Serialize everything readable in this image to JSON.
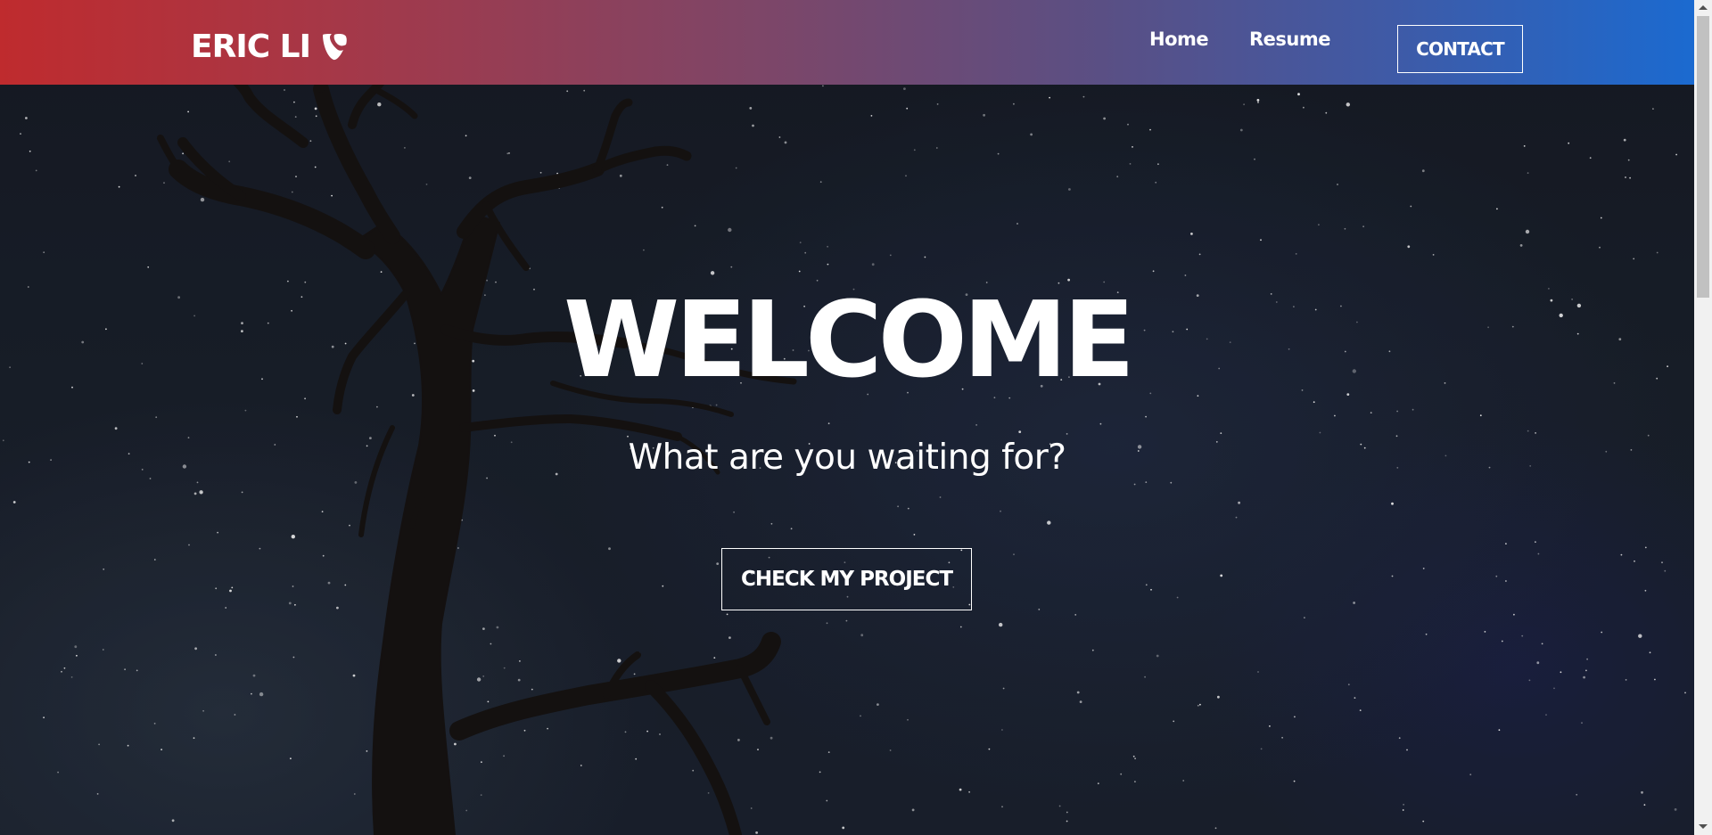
{
  "navbar": {
    "brand": "ERIC LI",
    "brand_logo_icon": "typo3-logo-icon",
    "links": [
      {
        "label": "Home"
      },
      {
        "label": "Resume"
      }
    ],
    "contact_label": "CONTACT",
    "gradient": [
      "#bf2b2e",
      "#1b6ad0"
    ]
  },
  "hero": {
    "title": "WELCOME",
    "subtitle": "What are you waiting for?",
    "cta_label": "CHECK MY PROJECT",
    "background": "night-sky-with-dead-tree"
  },
  "scrollbar": {
    "up_icon": "scroll-up-arrow-icon",
    "down_icon": "scroll-down-arrow-icon"
  }
}
